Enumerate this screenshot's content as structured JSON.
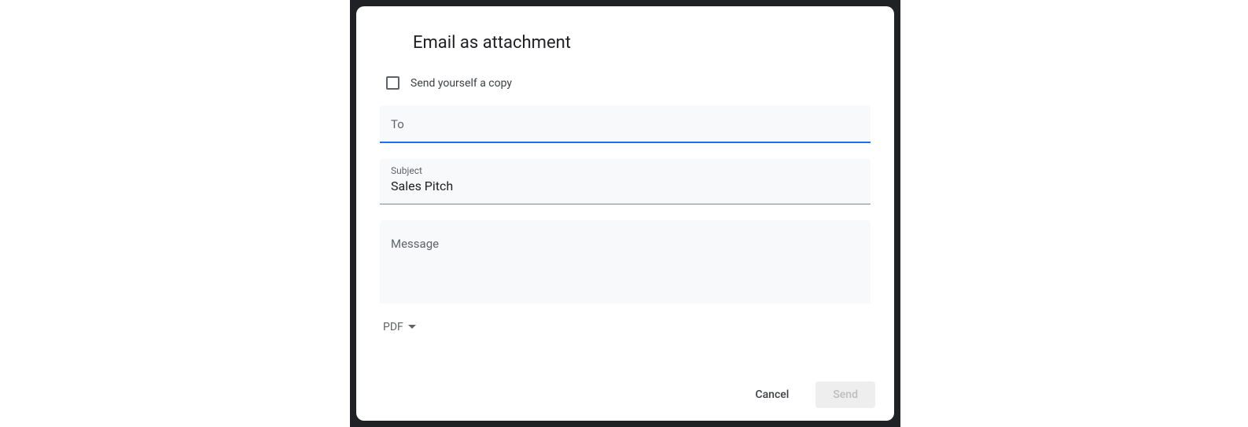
{
  "dialog": {
    "title": "Email as attachment",
    "checkbox_label": "Send yourself a copy",
    "to_placeholder": "To",
    "subject_label": "Subject",
    "subject_value": "Sales Pitch",
    "message_placeholder": "Message",
    "format_selected": "PDF",
    "cancel_label": "Cancel",
    "send_label": "Send"
  }
}
